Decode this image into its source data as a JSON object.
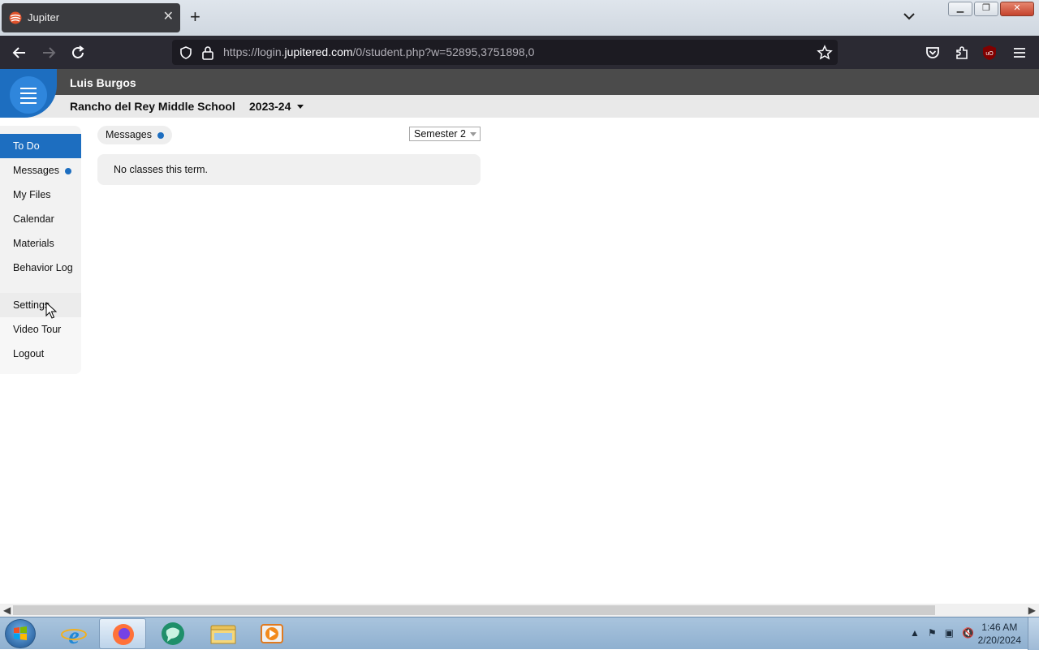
{
  "browser": {
    "tab_title": "Jupiter",
    "url_prefix": "https://login.",
    "url_domain": "jupitered.com",
    "url_path": "/0/student.php?w=52895,3751898,0"
  },
  "header": {
    "user_name": "Luis Burgos",
    "school": "Rancho del Rey Middle School",
    "year": "2023-24"
  },
  "sidebar": {
    "items": [
      {
        "label": "To Do"
      },
      {
        "label": "Messages"
      },
      {
        "label": "My Files"
      },
      {
        "label": "Calendar"
      },
      {
        "label": "Materials"
      },
      {
        "label": "Behavior Log"
      }
    ],
    "lower_items": [
      {
        "label": "Settings"
      },
      {
        "label": "Video Tour"
      },
      {
        "label": "Logout"
      }
    ]
  },
  "main": {
    "messages_label": "Messages",
    "semester": "Semester 2",
    "empty_message": "No classes this term."
  },
  "taskbar": {
    "time": "1:46 AM",
    "date": "2/20/2024"
  },
  "colors": {
    "accent": "#1d6ec0",
    "header_bg": "#4b4b4b"
  }
}
